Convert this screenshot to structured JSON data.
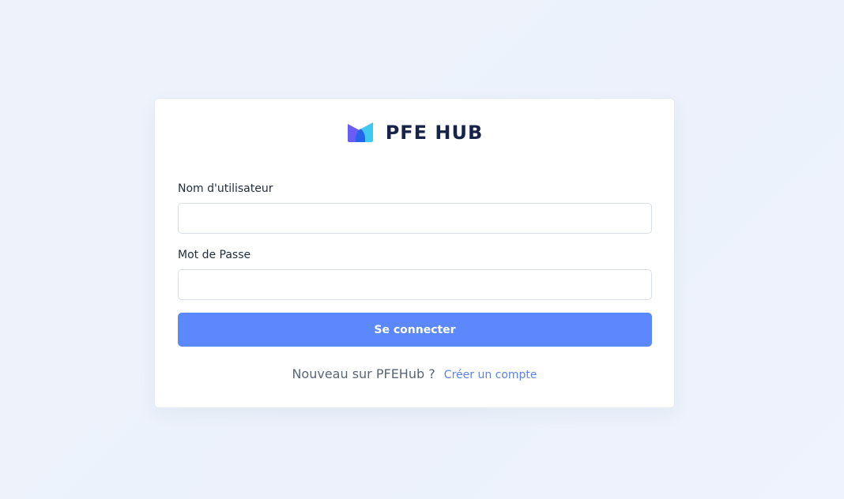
{
  "brand": {
    "logo_icon": "pfehub-logo-icon",
    "name": "PFE HUB",
    "colors": {
      "logo_left": "#6a5cf6",
      "logo_right": "#3fc9f0",
      "logo_center": "#2563eb",
      "name": "#172447"
    }
  },
  "form": {
    "username": {
      "label": "Nom d'utilisateur",
      "value": "",
      "placeholder": ""
    },
    "password": {
      "label": "Mot de Passe",
      "value": "",
      "placeholder": ""
    },
    "submit_label": "Se connecter"
  },
  "signup": {
    "prompt": "Nouveau sur PFEHub ?",
    "link_label": "Créer un compte"
  },
  "colors": {
    "background": "#edf2fb",
    "primary_button": "#5b88fc",
    "link": "#5b82f0"
  }
}
